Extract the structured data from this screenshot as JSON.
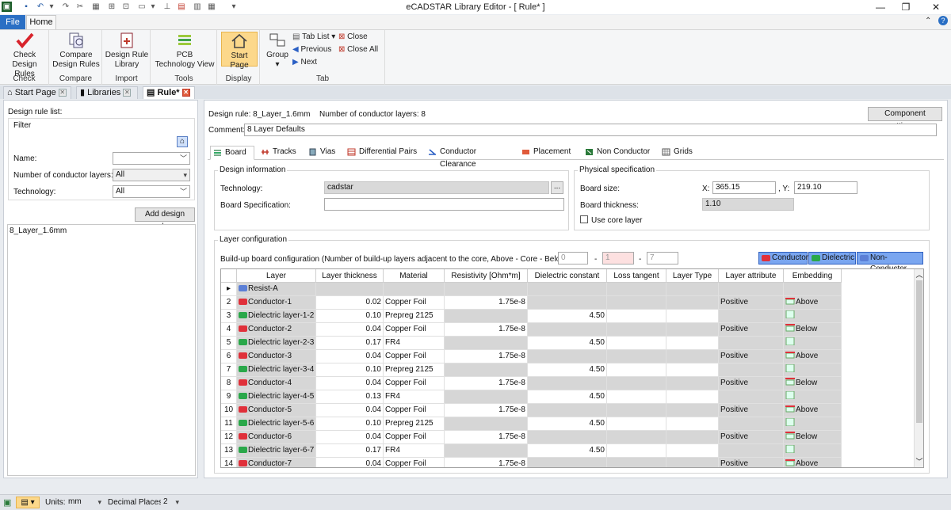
{
  "window": {
    "title": "eCADSTAR Library Editor - [ Rule* ]"
  },
  "menu": {
    "file": "File",
    "home": "Home"
  },
  "ribbon": {
    "groups": [
      {
        "label": "Check",
        "buttons": [
          {
            "label1": "Check",
            "label2": "Design Rules"
          }
        ]
      },
      {
        "label": "Compare",
        "buttons": [
          {
            "label1": "Compare",
            "label2": "Design Rules"
          }
        ]
      },
      {
        "label": "Import",
        "buttons": [
          {
            "label1": "Design Rule",
            "label2": "Library"
          }
        ]
      },
      {
        "label": "Tools",
        "buttons": [
          {
            "label1": "PCB",
            "label2": "Technology View"
          }
        ]
      },
      {
        "label": "Display",
        "buttons": [
          {
            "label1": "Start Page",
            "label2": ""
          }
        ]
      },
      {
        "label": "Tab",
        "group_btn": "Group",
        "tab_list": "Tab List",
        "previous": "Previous",
        "next": "Next",
        "close": "Close",
        "close_all": "Close All"
      }
    ]
  },
  "doc_tabs": [
    "Start Page",
    "Libraries",
    "Rule*"
  ],
  "left": {
    "header": "Design rule list:",
    "filter": "Filter",
    "name_label": "Name:",
    "name_value": "",
    "layers_label": "Number of conductor layers:",
    "layers_value": "All",
    "tech_label": "Technology:",
    "tech_value": "All",
    "add_btn": "Add design rule...",
    "items": [
      "8_Layer_1.6mm"
    ]
  },
  "right": {
    "design_rule_label": "Design rule:",
    "design_rule_value": "8_Layer_1.6mm",
    "num_layers_label": "Number of conductor layers:",
    "num_layers_value": "8",
    "component_btn": "Component settings...",
    "comment_label": "Comment:",
    "comment_value": "8 Layer Defaults",
    "tabs": [
      "Board",
      "Tracks",
      "Vias",
      "Differential Pairs",
      "Conductor Clearance",
      "Placement",
      "Non Conductor",
      "Grids"
    ],
    "design_info": {
      "legend": "Design information",
      "tech_label": "Technology:",
      "tech_value": "cadstar",
      "browse": "...",
      "spec_label": "Board Specification:",
      "spec_value": ""
    },
    "physical": {
      "legend": "Physical specification",
      "size_label": "Board size:",
      "x_label": "X:",
      "x_value": "365.15",
      "y_label": ", Y:",
      "y_value": "219.10",
      "thick_label": "Board thickness:",
      "thick_value": "1.10",
      "core_label": "Use core layer"
    },
    "layer_config": {
      "legend": "Layer configuration",
      "buildup_label": "Build-up board configuration (Number of build-up layers adjacent to the core, Above - Core - Below):",
      "above": "0",
      "core": "1",
      "below": "7",
      "dash": "-",
      "legend_conductor": "Conductor",
      "legend_dielectric": "Dielectric",
      "legend_nonconductor": "Non-Conductor"
    }
  },
  "colors": {
    "conductor": "#e0303a",
    "dielectric": "#2aa84a",
    "resist": "#5b7fd6",
    "accent": "#2a6fc4"
  },
  "grid": {
    "headers": [
      "Layer",
      "Layer thickness",
      "Material",
      "Resistivity [Ohm*m]",
      "Dielectric constant",
      "Loss tangent",
      "Layer Type",
      "Layer attribute",
      "Embedding"
    ],
    "rows": [
      {
        "num": "",
        "kind": "resist",
        "name": "Resist-A",
        "thick": "",
        "mat": "",
        "res": "",
        "diel": "",
        "attr": "",
        "emb": ""
      },
      {
        "num": "2",
        "kind": "conductor",
        "name": "Conductor-1",
        "thick": "0.02",
        "mat": "Copper Foil",
        "res": "1.75e-8",
        "diel": "",
        "attr": "Positive",
        "emb": "Above"
      },
      {
        "num": "3",
        "kind": "dielectric",
        "name": "Dielectric layer-1-2",
        "thick": "0.10",
        "mat": "Prepreg 2125",
        "res": "",
        "diel": "4.50",
        "attr": "",
        "emb": ""
      },
      {
        "num": "4",
        "kind": "conductor",
        "name": "Conductor-2",
        "thick": "0.04",
        "mat": "Copper Foil",
        "res": "1.75e-8",
        "diel": "",
        "attr": "Positive",
        "emb": "Below"
      },
      {
        "num": "5",
        "kind": "dielectric",
        "name": "Dielectric layer-2-3",
        "thick": "0.17",
        "mat": "FR4",
        "res": "",
        "diel": "4.50",
        "attr": "",
        "emb": ""
      },
      {
        "num": "6",
        "kind": "conductor",
        "name": "Conductor-3",
        "thick": "0.04",
        "mat": "Copper Foil",
        "res": "1.75e-8",
        "diel": "",
        "attr": "Positive",
        "emb": "Above"
      },
      {
        "num": "7",
        "kind": "dielectric",
        "name": "Dielectric layer-3-4",
        "thick": "0.10",
        "mat": "Prepreg 2125",
        "res": "",
        "diel": "4.50",
        "attr": "",
        "emb": ""
      },
      {
        "num": "8",
        "kind": "conductor",
        "name": "Conductor-4",
        "thick": "0.04",
        "mat": "Copper Foil",
        "res": "1.75e-8",
        "diel": "",
        "attr": "Positive",
        "emb": "Below"
      },
      {
        "num": "9",
        "kind": "dielectric",
        "name": "Dielectric layer-4-5",
        "thick": "0.13",
        "mat": "FR4",
        "res": "",
        "diel": "4.50",
        "attr": "",
        "emb": ""
      },
      {
        "num": "10",
        "kind": "conductor",
        "name": "Conductor-5",
        "thick": "0.04",
        "mat": "Copper Foil",
        "res": "1.75e-8",
        "diel": "",
        "attr": "Positive",
        "emb": "Above"
      },
      {
        "num": "11",
        "kind": "dielectric",
        "name": "Dielectric layer-5-6",
        "thick": "0.10",
        "mat": "Prepreg 2125",
        "res": "",
        "diel": "4.50",
        "attr": "",
        "emb": ""
      },
      {
        "num": "12",
        "kind": "conductor",
        "name": "Conductor-6",
        "thick": "0.04",
        "mat": "Copper Foil",
        "res": "1.75e-8",
        "diel": "",
        "attr": "Positive",
        "emb": "Below"
      },
      {
        "num": "13",
        "kind": "dielectric",
        "name": "Dielectric layer-6-7",
        "thick": "0.17",
        "mat": "FR4",
        "res": "",
        "diel": "4.50",
        "attr": "",
        "emb": ""
      },
      {
        "num": "14",
        "kind": "conductor",
        "name": "Conductor-7",
        "thick": "0.04",
        "mat": "Copper Foil",
        "res": "1.75e-8",
        "diel": "",
        "attr": "Positive",
        "emb": "Above"
      }
    ]
  },
  "status": {
    "units_label": "Units:",
    "units_value": "mm",
    "decimals_label": "Decimal Places:",
    "decimals_value": "2"
  }
}
